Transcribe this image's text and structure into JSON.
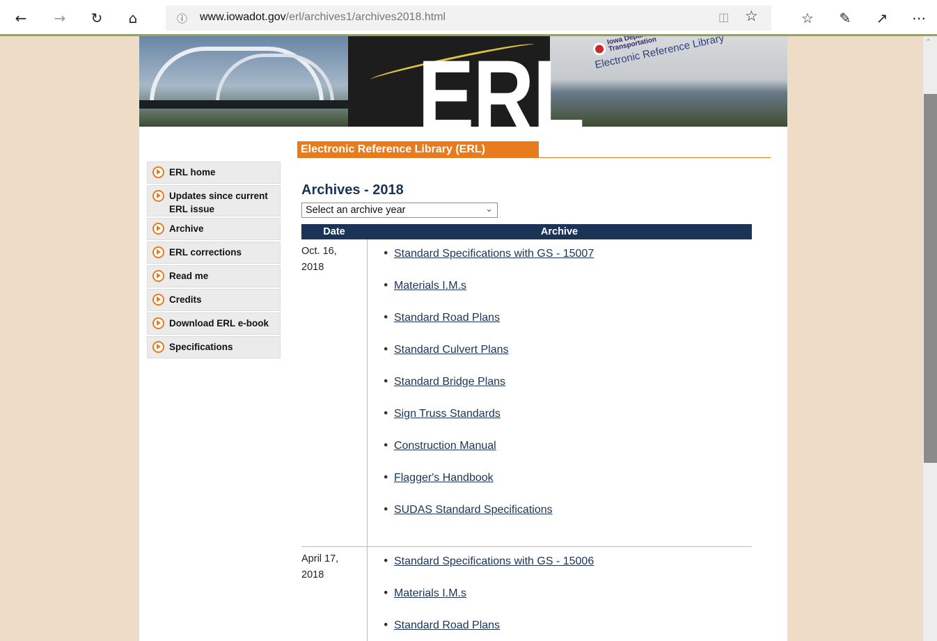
{
  "browser": {
    "back_icon": "arrow-left-icon",
    "forward_icon": "arrow-right-icon",
    "refresh_icon": "refresh-icon",
    "home_icon": "home-icon",
    "url_host": "www.iowadot.gov",
    "url_path": "/erl/archives1/archives2018.html",
    "toolbar_icons": [
      "reading-view-icon",
      "favorite-star-icon",
      "favorites-list-icon",
      "pen-notes-icon",
      "share-icon",
      "more-icon"
    ]
  },
  "banner": {
    "erl_letters": "ERL",
    "org": "Iowa Department of Transportation",
    "library": "Electronic Reference Library"
  },
  "header": {
    "tab_label": "Electronic Reference Library (ERL)"
  },
  "sidebar": {
    "items": [
      {
        "label": "ERL home"
      },
      {
        "label": "Updates since current ERL issue"
      },
      {
        "label": "Archive"
      },
      {
        "label": "ERL corrections"
      },
      {
        "label": "Read me"
      },
      {
        "label": "Credits"
      },
      {
        "label": "Download ERL e-book"
      },
      {
        "label": "Specifications"
      }
    ]
  },
  "main": {
    "title": "Archives - 2018",
    "select": {
      "value": "Select an archive year"
    },
    "table": {
      "headers": {
        "date": "Date",
        "archive": "Archive"
      },
      "rows": [
        {
          "date_line1": "Oct. 16,",
          "date_line2": "2018",
          "docs": [
            "Standard Specifications with GS - 15007",
            "Materials I.M.s",
            "Standard Road Plans",
            "Standard Culvert Plans",
            "Standard Bridge Plans",
            "Sign Truss Standards",
            "Construction Manual",
            "Flagger's Handbook",
            "SUDAS Standard Specifications"
          ]
        },
        {
          "date_line1": "April 17,",
          "date_line2": "2018",
          "docs": [
            "Standard Specifications with GS - 15006",
            "Materials I.M.s",
            "Standard Road Plans"
          ]
        }
      ]
    }
  }
}
